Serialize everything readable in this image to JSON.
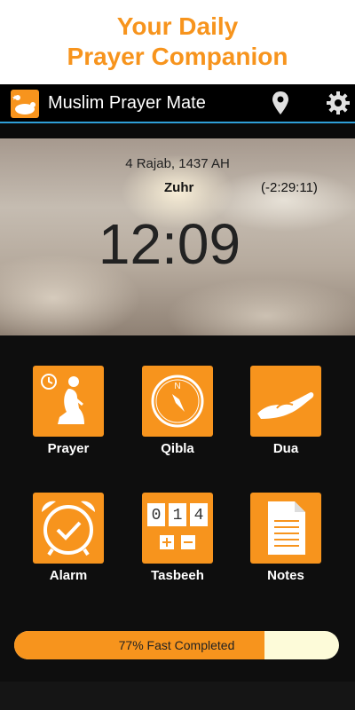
{
  "promo": {
    "line1": "Your Daily",
    "line2": "Prayer Companion"
  },
  "appbar": {
    "title": "Muslim Prayer Mate",
    "icons": [
      "app-logo-icon",
      "location-pin-icon",
      "gear-icon"
    ]
  },
  "hero": {
    "hijri_date": "4 Rajab, 1437 AH",
    "next_prayer": "Zuhr",
    "countdown": "(-2:29:11)",
    "time": "12:09"
  },
  "menu": {
    "prayer": "Prayer",
    "qibla": "Qibla",
    "dua": "Dua",
    "alarm": "Alarm",
    "tasbeeh": "Tasbeeh",
    "notes": "Notes"
  },
  "tasbeeh_digits": [
    "0",
    "1",
    "4"
  ],
  "fast": {
    "label": "77% Fast Completed",
    "percent": 77
  },
  "colors": {
    "accent": "#f7941d",
    "divider": "#2f9fd8",
    "background": "#0e0e0e",
    "progress_track": "#fdfbd9"
  }
}
